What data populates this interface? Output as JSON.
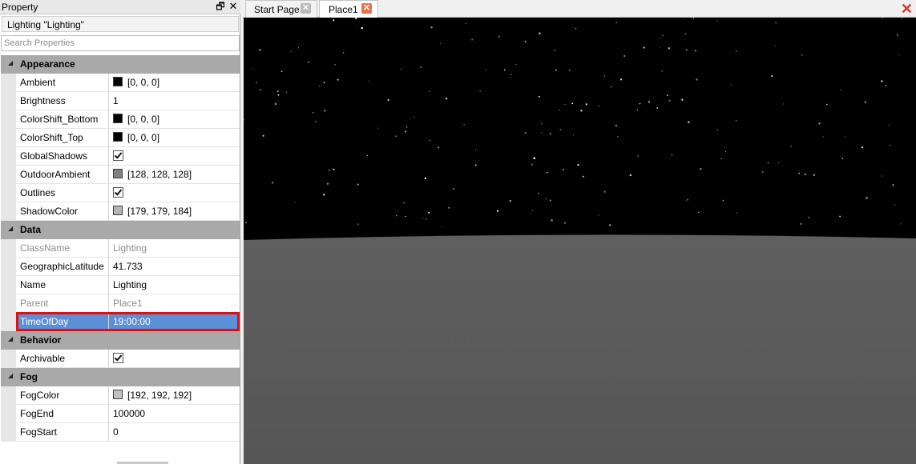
{
  "panel": {
    "title": "Property",
    "selected_object": "Lighting \"Lighting\"",
    "search_placeholder": "Search Properties"
  },
  "categories": [
    {
      "name": "Appearance",
      "properties": [
        {
          "name": "Ambient",
          "value": "[0, 0, 0]",
          "kind": "color",
          "color": "#000000"
        },
        {
          "name": "Brightness",
          "value": "1",
          "kind": "text"
        },
        {
          "name": "ColorShift_Bottom",
          "value": "[0, 0, 0]",
          "kind": "color",
          "color": "#000000"
        },
        {
          "name": "ColorShift_Top",
          "value": "[0, 0, 0]",
          "kind": "color",
          "color": "#000000"
        },
        {
          "name": "GlobalShadows",
          "value": "",
          "kind": "bool",
          "checked": true
        },
        {
          "name": "OutdoorAmbient",
          "value": "[128, 128, 128]",
          "kind": "color",
          "color": "#808080"
        },
        {
          "name": "Outlines",
          "value": "",
          "kind": "bool",
          "checked": true
        },
        {
          "name": "ShadowColor",
          "value": "[179, 179, 184]",
          "kind": "color",
          "color": "#b3b3b8"
        }
      ]
    },
    {
      "name": "Data",
      "properties": [
        {
          "name": "ClassName",
          "value": "Lighting",
          "kind": "text",
          "readonly": true
        },
        {
          "name": "GeographicLatitude",
          "value": "41.733",
          "kind": "text"
        },
        {
          "name": "Name",
          "value": "Lighting",
          "kind": "text"
        },
        {
          "name": "Parent",
          "value": "Place1",
          "kind": "text",
          "readonly": true
        },
        {
          "name": "TimeOfDay",
          "value": "19:00:00",
          "kind": "text",
          "selected": true
        }
      ]
    },
    {
      "name": "Behavior",
      "properties": [
        {
          "name": "Archivable",
          "value": "",
          "kind": "bool",
          "checked": true
        }
      ]
    },
    {
      "name": "Fog",
      "properties": [
        {
          "name": "FogColor",
          "value": "[192, 192, 192]",
          "kind": "color",
          "color": "#c0c0c0"
        },
        {
          "name": "FogEnd",
          "value": "100000",
          "kind": "text"
        },
        {
          "name": "FogStart",
          "value": "0",
          "kind": "text"
        }
      ]
    }
  ],
  "tabs": [
    {
      "label": "Start Page",
      "active": false,
      "close_color": "#b8b8b8"
    },
    {
      "label": "Place1",
      "active": true,
      "close_color": "#e8734a"
    }
  ],
  "icons": {
    "panel_float": "float-window-icon",
    "panel_close": "close-icon",
    "tab_close": "close-icon",
    "viewport_close": "close-icon",
    "category_toggle": "collapse-triangle-icon",
    "close_x_color": "#d6382a"
  },
  "viewport": {
    "sky_color": "#000000",
    "ground_color": "#5e5e5e"
  }
}
